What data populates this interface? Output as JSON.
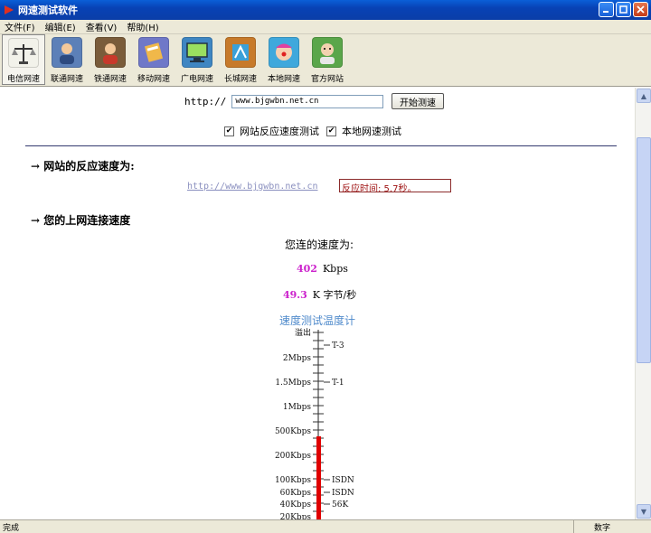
{
  "window": {
    "title": "网速测试软件"
  },
  "menu": [
    "文件(F)",
    "编辑(E)",
    "查看(V)",
    "帮助(H)"
  ],
  "toolbar": [
    {
      "label": "电信网速",
      "icon": "scale-icon",
      "color": "#f2f2ea"
    },
    {
      "label": "联通网速",
      "icon": "person-icon",
      "color": "#5c80b8"
    },
    {
      "label": "铁通网速",
      "icon": "person-icon",
      "color": "#7a5c3a"
    },
    {
      "label": "移动网速",
      "icon": "book-icon",
      "color": "#6f78c8"
    },
    {
      "label": "广电网速",
      "icon": "monitor-icon",
      "color": "#3f86c2"
    },
    {
      "label": "长城网速",
      "icon": "book-icon",
      "color": "#c77a2a"
    },
    {
      "label": "本地网速",
      "icon": "clown-icon",
      "color": "#3fa8dc"
    },
    {
      "label": "官方网站",
      "icon": "person-icon",
      "color": "#5aa64a"
    }
  ],
  "test": {
    "url_label": "http://",
    "url_value": "www.bjgwbn.net.cn",
    "start_button": "开始测速",
    "check1": "网站反应速度测试",
    "check2": "本地网速测试"
  },
  "response": {
    "heading": "→ 网站的反应速度为:",
    "link": "http://www.bjgwbn.net.cn",
    "result": "反应时间: 5.7秒。"
  },
  "speed": {
    "heading": "→ 您的上网连接速度",
    "title": "您连的速度为:",
    "kbps_value": "402",
    "kbps_unit": "Kbps",
    "kb_value": "49.3",
    "kb_unit": "K 字节/秒"
  },
  "meter": {
    "title": "速度测试温度计",
    "left_labels": [
      "溢出",
      "2Mbps",
      "1.5Mbps",
      "1Mbps",
      "500Kbps",
      "200Kbps",
      "100Kbps",
      "60Kbps",
      "40Kbps",
      "20Kbps"
    ],
    "right_labels": [
      "T-3",
      "T-1",
      "ISDN",
      "ISDN",
      "56K"
    ],
    "fill_color": "#e00000"
  },
  "status": {
    "left": "完成",
    "right": "数字"
  }
}
